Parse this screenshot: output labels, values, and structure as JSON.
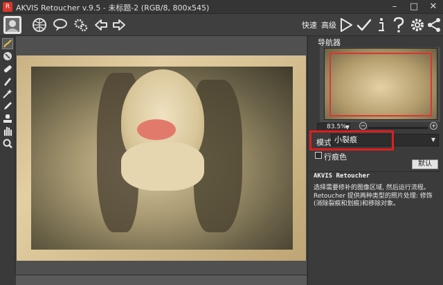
{
  "window": {
    "title": "AKVIS Retoucher v.9.5 - 未标题-2 (RGB/8, 800x545)",
    "logo_text": "R",
    "controls": {
      "minimize": "–",
      "maximize": "□",
      "close": "✕"
    }
  },
  "toolbar": {
    "left_icons": [
      "app-photo-icon",
      "globe-icon",
      "comment-icon",
      "settings-gears-icon",
      "back-arrow-icon",
      "forward-arrow-icon"
    ],
    "quick_label": "快速",
    "advanced_label": "高级",
    "right_icons": [
      "run-play-icon",
      "apply-check-icon",
      "info-icon",
      "help-icon",
      "preferences-gear-icon",
      "share-icon"
    ]
  },
  "tools": [
    "brush-icon",
    "eraser-cone-icon",
    "bandage-icon",
    "chisel-icon",
    "magic-wand-icon",
    "pencil-icon",
    "clone-stamp-icon",
    "hand-icon",
    "zoom-icon"
  ],
  "navigator": {
    "title": "导航器",
    "zoom_value": "83.5%"
  },
  "settings": {
    "mode_label": "模式:",
    "mode_value": "小裂痕",
    "strokes_label": "行痕色",
    "default_button": "默认",
    "highlight_color": "#e01e1e"
  },
  "help": {
    "title": "AKVIS Retoucher",
    "lines": [
      "选择需要修补的图像区域, 然后运行流程。",
      "Retoucher 提供两种类型的照片处理: 修饰(消除裂痕和划痕)和移除对象。"
    ]
  }
}
